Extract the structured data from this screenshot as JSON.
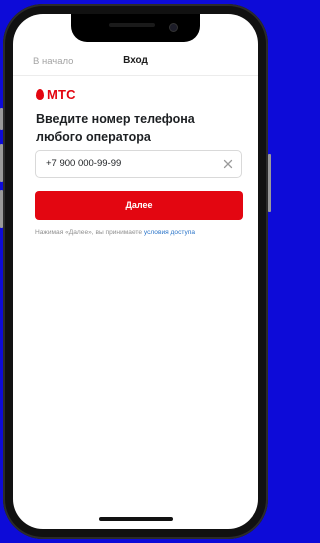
{
  "header": {
    "back_label": "В начало",
    "title": "Вход"
  },
  "brand": {
    "logo_text": "МТС",
    "brand_color": "#e30611",
    "logo_icon": "mts-egg-icon"
  },
  "main": {
    "heading": "Введите номер телефона любого оператора",
    "phone_field": {
      "value": "+7 900 000-99-99",
      "clear_icon": "close-icon"
    },
    "next_button_label": "Далее",
    "terms_prefix": "Нажимая «Далее», вы принимаете ",
    "terms_link": "условия доступа"
  },
  "colors": {
    "background": "#0d0bd8",
    "accent": "#e30611",
    "link": "#2a74c9"
  }
}
